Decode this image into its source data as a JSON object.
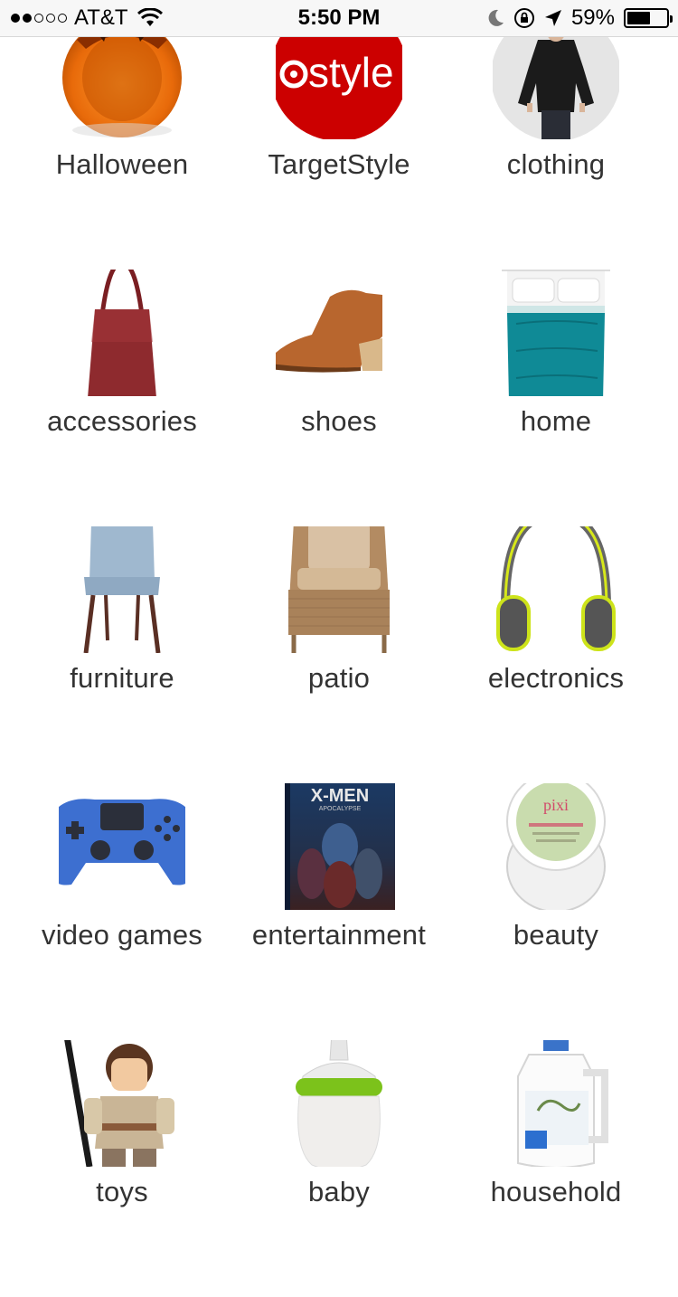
{
  "status_bar": {
    "carrier": "AT&T",
    "time": "5:50 PM",
    "battery_percent": "59%",
    "battery_level": 0.59,
    "signal_bars_filled": 2,
    "signal_bars_total": 5,
    "icons": [
      "wifi-icon",
      "moon-icon",
      "rotation-lock-icon",
      "location-arrow-icon",
      "battery-icon"
    ]
  },
  "categories": [
    {
      "label": "Halloween",
      "image": "pumpkin-bowl"
    },
    {
      "label": "TargetStyle",
      "image": "target-style-logo",
      "logo_text": "style"
    },
    {
      "label": "clothing",
      "image": "model-black-top"
    },
    {
      "label": "accessories",
      "image": "red-tote-bag"
    },
    {
      "label": "shoes",
      "image": "brown-ankle-boot"
    },
    {
      "label": "home",
      "image": "teal-bed"
    },
    {
      "label": "furniture",
      "image": "blue-chair"
    },
    {
      "label": "patio",
      "image": "wicker-armchair"
    },
    {
      "label": "electronics",
      "image": "headphones"
    },
    {
      "label": "video games",
      "image": "game-controller"
    },
    {
      "label": "entertainment",
      "image": "movie-cover",
      "cover_title": "X-MEN",
      "cover_subtitle": "APOCALYPSE"
    },
    {
      "label": "beauty",
      "image": "pixi-jar",
      "brand_text": "pixi"
    },
    {
      "label": "toys",
      "image": "lego-minifigure"
    },
    {
      "label": "baby",
      "image": "baby-bottle"
    },
    {
      "label": "household",
      "image": "detergent-bottle"
    }
  ],
  "colors": {
    "target_red": "#cc0000",
    "label_text": "#333333",
    "status_bar_bg": "#f7f7f7"
  }
}
